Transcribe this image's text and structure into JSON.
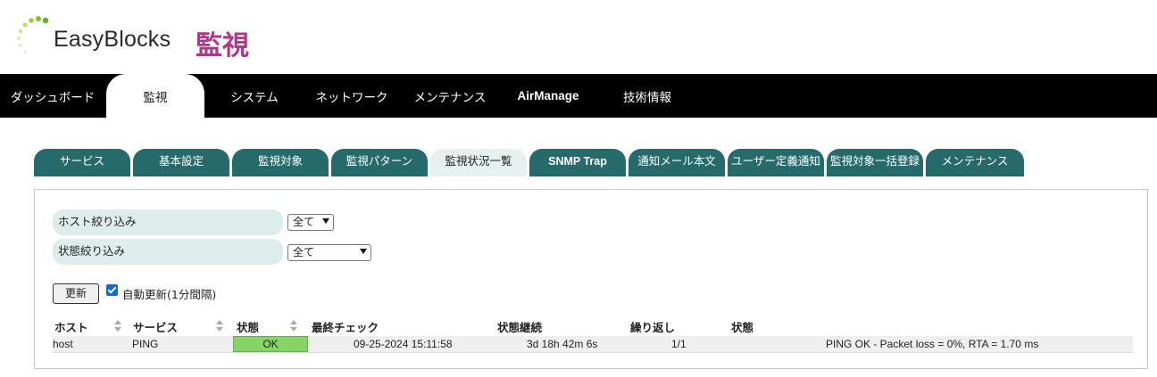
{
  "header": {
    "brand": "EasyBlocks",
    "page": "監視"
  },
  "mainnav": [
    {
      "label": "ダッシュボード"
    },
    {
      "label": "監視",
      "active": true
    },
    {
      "label": "システム"
    },
    {
      "label": "ネットワーク"
    },
    {
      "label": "メンテナンス"
    },
    {
      "label": "AirManage"
    },
    {
      "label": "技術情報"
    }
  ],
  "subtabs": [
    {
      "label": "サービス"
    },
    {
      "label": "基本設定"
    },
    {
      "label": "監視対象"
    },
    {
      "label": "監視パターン"
    },
    {
      "label": "監視状況一覧",
      "active": true
    },
    {
      "label": "SNMP Trap"
    },
    {
      "label": "通知メール本文"
    },
    {
      "label": "ユーザー定義通知"
    },
    {
      "label": "監視対象一括登録"
    },
    {
      "label": "メンテナンス"
    }
  ],
  "filters": {
    "host_label": "ホスト絞り込み",
    "host_value": "全て",
    "status_label": "状態絞り込み",
    "status_value": "全て"
  },
  "controls": {
    "refresh_label": "更新",
    "auto_refresh_label": "自動更新(1分間隔)",
    "auto_refresh_checked": true
  },
  "table": {
    "columns": [
      "ホスト",
      "サービス",
      "状態",
      "最終チェック",
      "状態継続",
      "繰り返し",
      "状態"
    ],
    "rows": [
      {
        "host": "host",
        "service": "PING",
        "state": "OK",
        "last_check": "09-25-2024 15:11:58",
        "duration": "3d 18h 42m 6s",
        "attempt": "1/1",
        "info": "PING OK - Packet loss = 0%, RTA = 1.70 ms"
      }
    ]
  },
  "colors": {
    "nav_bg": "#000000",
    "tab_bg": "#266a6b",
    "tab_active_bg": "#e6f0ee",
    "brand_accent": "#b0368a",
    "ok_green": "#85d465"
  }
}
